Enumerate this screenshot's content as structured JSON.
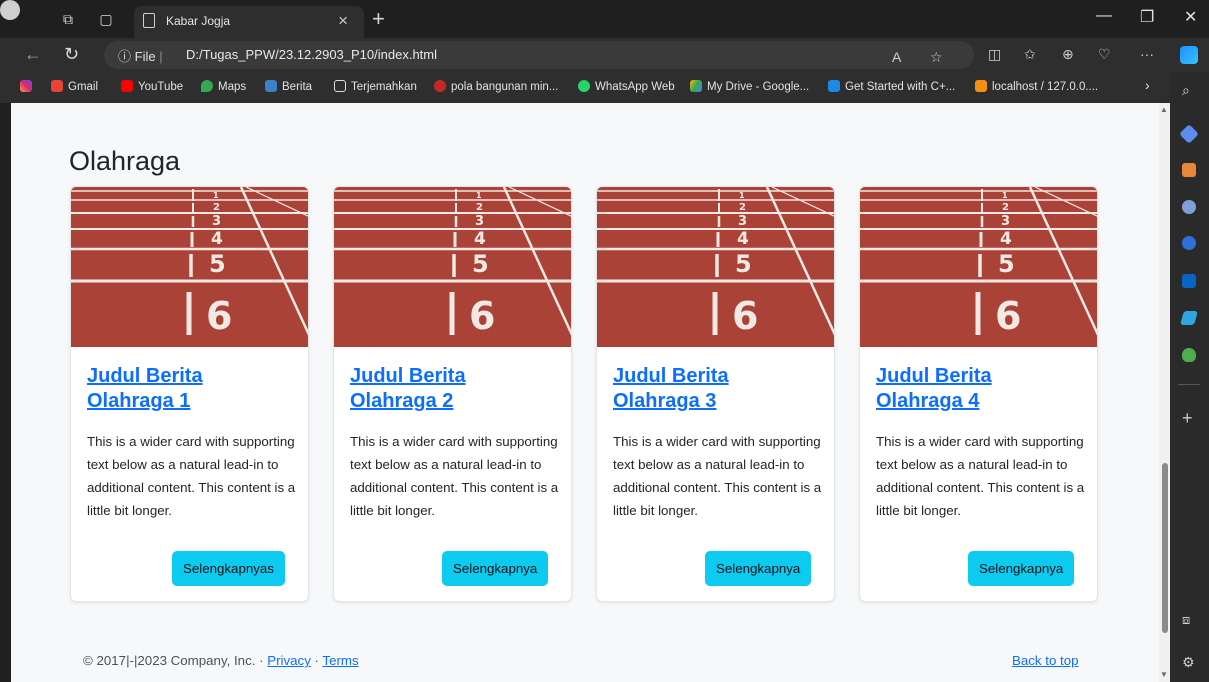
{
  "browser": {
    "tab_title": "Kabar Jogja",
    "url_info_label": "File",
    "url": "D:/Tugas_PPW/23.12.2903_P10/index.html",
    "bookmarks": [
      "Gmail",
      "YouTube",
      "Maps",
      "Berita",
      "Terjemahkan",
      "pola bangunan min...",
      "WhatsApp Web",
      "My Drive - Google...",
      "Get Started with C+...",
      "localhost / 127.0.0...."
    ]
  },
  "page": {
    "section_title": "Olahraga",
    "cards": [
      {
        "title": "Judul Berita Olahraga 1",
        "text": "This is a wider card with supporting text below as a natural lead-in to additional content. This content is a little bit longer.",
        "button": "Selengkapnyas"
      },
      {
        "title": "Judul Berita Olahraga 2",
        "text": "This is a wider card with supporting text below as a natural lead-in to additional content. This content is a little bit longer.",
        "button": "Selengkapnya"
      },
      {
        "title": "Judul Berita Olahraga 3",
        "text": "This is a wider card with supporting text below as a natural lead-in to additional content. This content is a little bit longer.",
        "button": "Selengkapnya"
      },
      {
        "title": "Judul Berita Olahraga 4",
        "text": "This is a wider card with supporting text below as a natural lead-in to additional content. This content is a little bit longer.",
        "button": "Selengkapnya"
      }
    ],
    "footer": {
      "copyright": "© 2017|-|2023 Company, Inc. · ",
      "privacy": "Privacy",
      "separator": " · ",
      "terms": "Terms",
      "back_to_top": "Back to top"
    }
  },
  "colors": {
    "accent": "#0d6efd",
    "button": "#0dcaf0",
    "track": "#b0453a"
  }
}
